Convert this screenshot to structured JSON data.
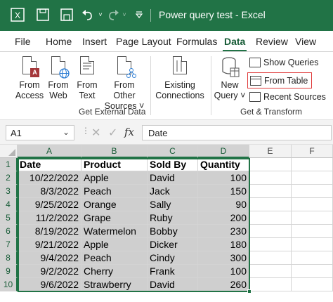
{
  "window": {
    "title": "Power query test  -  Excel"
  },
  "quick_access": [
    "excel-logo-icon",
    "save-icon",
    "autosave-icon",
    "undo-icon",
    "redo-icon",
    "customize-icon"
  ],
  "tabs": [
    "File",
    "Home",
    "Insert",
    "Page Layout",
    "Formulas",
    "Data",
    "Review",
    "View"
  ],
  "active_tab": "Data",
  "ribbon": {
    "get_external_data": {
      "group_label": "Get External Data",
      "buttons": [
        {
          "line1": "From",
          "line2": "Access"
        },
        {
          "line1": "From",
          "line2": "Web"
        },
        {
          "line1": "From",
          "line2": "Text"
        },
        {
          "line1": "From Other",
          "line2": "Sources ˅"
        },
        {
          "line1": "Existing",
          "line2": "Connections"
        }
      ]
    },
    "get_transform": {
      "group_label": "Get & Transform",
      "new_query": {
        "line1": "New",
        "line2": "Query ˅"
      },
      "show_queries": "Show Queries",
      "from_table": "From Table",
      "recent_sources": "Recent Sources"
    },
    "access_badge": "A"
  },
  "formula_bar": {
    "name_box": "A1",
    "formula": "Date",
    "fx": "fx"
  },
  "columns": [
    "A",
    "B",
    "C",
    "D",
    "E",
    "F"
  ],
  "table": {
    "headers": [
      "Date",
      "Product",
      "Sold By",
      "Quantity"
    ],
    "rows": [
      [
        "10/22/2022",
        "Apple",
        "David",
        "100"
      ],
      [
        "8/3/2022",
        "Peach",
        "Jack",
        "150"
      ],
      [
        "9/25/2022",
        "Orange",
        "Sally",
        "90"
      ],
      [
        "11/2/2022",
        "Grape",
        "Ruby",
        "200"
      ],
      [
        "8/19/2022",
        "Watermelon",
        "Bobby",
        "230"
      ],
      [
        "9/21/2022",
        "Apple",
        "Dicker",
        "180"
      ],
      [
        "9/4/2022",
        "Peach",
        "Cindy",
        "300"
      ],
      [
        "9/2/2022",
        "Cherry",
        "Frank",
        "100"
      ],
      [
        "9/6/2022",
        "Strawberry",
        "David",
        "260"
      ]
    ]
  },
  "row_numbers": [
    "1",
    "2",
    "3",
    "4",
    "5",
    "6",
    "7",
    "8",
    "9",
    "10"
  ],
  "colors": {
    "accent": "#217346",
    "selection_shade": "#cfcfcf",
    "highlight_box": "#e03c3c"
  }
}
